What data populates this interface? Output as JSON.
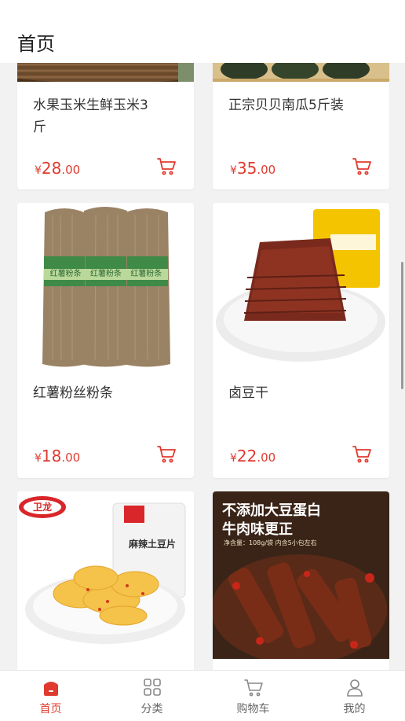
{
  "header": {
    "title": "首页"
  },
  "products": [
    {
      "name": "水果玉米生鲜玉米3斤",
      "currency": "¥",
      "price_int": "28",
      "price_dec": ".00"
    },
    {
      "name": "正宗贝贝南瓜5斤装",
      "currency": "¥",
      "price_int": "35",
      "price_dec": ".00"
    },
    {
      "name": "红薯粉丝粉条",
      "currency": "¥",
      "price_int": "18",
      "price_dec": ".00"
    },
    {
      "name": "卤豆干",
      "currency": "¥",
      "price_int": "22",
      "price_dec": ".00"
    }
  ],
  "images": {
    "noodle_tag": "红薯粉条",
    "chips_brand": "卫龙",
    "chips_label": "麻辣土豆片",
    "beef_line1": "不添加大豆蛋白",
    "beef_line2": "牛肉味更正",
    "beef_net": "净含量：108g/袋  内含5小包左右"
  },
  "tabbar": [
    {
      "label": "首页",
      "icon": "home-icon",
      "active": true
    },
    {
      "label": "分类",
      "icon": "category-grid-icon",
      "active": false
    },
    {
      "label": "购物车",
      "icon": "cart-icon",
      "active": false
    },
    {
      "label": "我的",
      "icon": "user-icon",
      "active": false
    }
  ],
  "colors": {
    "accent": "#e03a2e",
    "text": "#333333",
    "background": "#f2f2f2"
  }
}
